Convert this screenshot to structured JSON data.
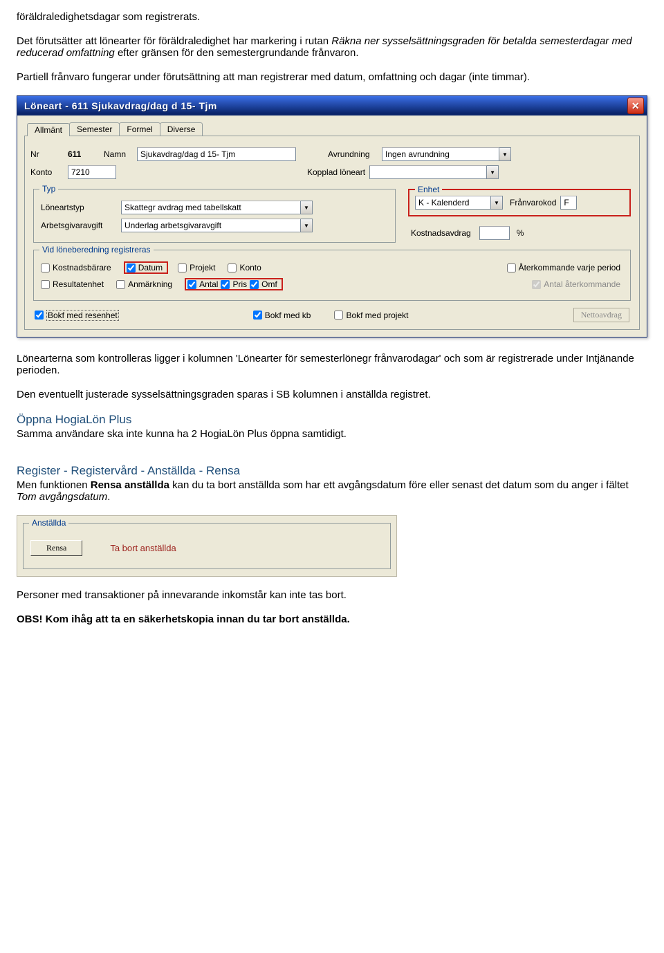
{
  "intro": {
    "p1": "föräldraledighetsdagar som registrerats.",
    "p2a": "Det förutsätter att lönearter för föräldraledighet har markering i rutan ",
    "p2b": "Räkna ner sysselsättningsgraden för betalda semesterdagar med reducerad omfattning",
    "p2c": " efter gränsen för den semestergrundande frånvaron.",
    "p3": "Partiell frånvaro fungerar under förutsättning att man registrerar med datum, omfattning och dagar (inte timmar)."
  },
  "dialog": {
    "title": "Löneart - 611 Sjukavdrag/dag d 15- Tjm",
    "tabs": [
      "Allmänt",
      "Semester",
      "Formel",
      "Diverse"
    ],
    "nr_label": "Nr",
    "nr_value": "611",
    "namn_label": "Namn",
    "namn_value": "Sjukavdrag/dag d 15- Tjm",
    "avrundning_label": "Avrundning",
    "avrundning_value": "Ingen avrundning",
    "konto_label": "Konto",
    "konto_value": "7210",
    "kopplad_label": "Kopplad löneart",
    "kopplad_value": "",
    "typ_title": "Typ",
    "loneartstyp_label": "Löneartstyp",
    "loneartstyp_value": "Skattegr avdrag med tabellskatt",
    "arbgiv_label": "Arbetsgivaravgift",
    "arbgiv_value": "Underlag arbetsgivaravgift",
    "enhet_title": "Enhet",
    "enhet_value": "K - Kalenderd",
    "franvarokod_label": "Frånvarokod",
    "franvarokod_value": "F",
    "kostnadsavdrag_label": "Kostnadsavdrag",
    "kostnadsavdrag_unit": "%",
    "regtitle": "Vid löneberedning registreras",
    "chk": {
      "kostnadsbarare": "Kostnadsbärare",
      "datum": "Datum",
      "projekt": "Projekt",
      "konto": "Konto",
      "aterkommande": "Återkommande varje period",
      "resultatenhet": "Resultatenhet",
      "anmarkning": "Anmärkning",
      "antal": "Antal",
      "pris": "Pris",
      "omf": "Omf",
      "antalater": "Antal återkommande"
    },
    "bokf1": "Bokf med resenhet",
    "bokf2": "Bokf med kb",
    "bokf3": "Bokf med projekt",
    "nettoavdrag": "Nettoavdrag"
  },
  "mid": {
    "p1": "Lönearterna som kontrolleras ligger i kolumnen 'Lönearter för semesterlönegr frånvarodagar' och som är registrerade under Intjänande perioden.",
    "p2": "Den eventuellt justerade sysselsättningsgraden sparas i SB kolumnen i anställda registret."
  },
  "open": {
    "head": "Öppna HogiaLön Plus",
    "p": "Samma användare ska inte kunna ha 2 HogiaLön Plus öppna samtidigt."
  },
  "rensa": {
    "head": "Register - Registervård - Anställda - Rensa",
    "p_a": "Men funktionen ",
    "p_b": "Rensa anställda",
    "p_c": " kan du ta bort anställda som har ett avgångsdatum före eller senast det datum som du anger i fältet ",
    "p_d": "Tom avgångsdatum",
    "p_e": "."
  },
  "panel2": {
    "group": "Anställda",
    "btn": "Rensa",
    "side": "Ta bort anställda"
  },
  "tail": {
    "p1": "Personer med transaktioner på innevarande inkomstår kan inte tas bort.",
    "p2a": "OBS!",
    "p2b": " Kom ihåg att ta en säkerhetskopia innan du tar bort anställda."
  }
}
